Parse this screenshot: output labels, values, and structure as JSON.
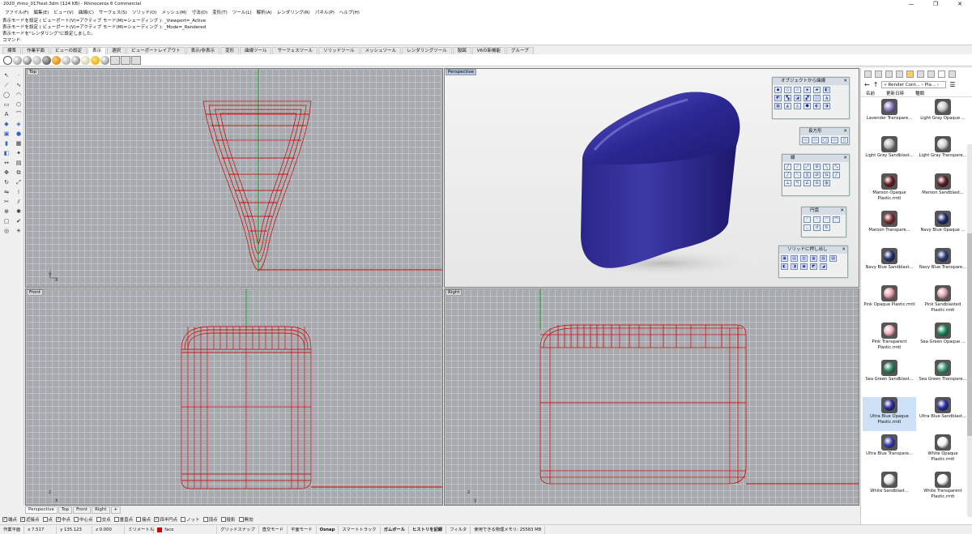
{
  "window": {
    "title": "2020_rhino_017test.3dm (124 KB) - Rhinoceros 6 Commercial",
    "controls": [
      "—",
      "❐",
      "✕"
    ]
  },
  "menu": [
    "ファイル(F)",
    "編集(E)",
    "ビュー(V)",
    "曲線(C)",
    "サーフェス(S)",
    "ソリッド(O)",
    "メッシュ(M)",
    "寸法(D)",
    "変形(T)",
    "ツール(L)",
    "解析(A)",
    "レンダリング(R)",
    "パネル(P)",
    "ヘルプ(H)"
  ],
  "command_history": [
    "表示モードを設定 ( ビューポート(V)=アクティブ  モード(M)=シェーディング ): _Viewport=_Active",
    "表示モードを設定 ( ビューポート(V)=アクティブ  モード(M)=シェーディング ): _Mode=_Rendered",
    "表示モードを\"レンダリング\"に設定しました。",
    "コマンド:"
  ],
  "toolbar_tabs": [
    {
      "label": "標準"
    },
    {
      "label": "作業平面"
    },
    {
      "label": "ビューの設定"
    },
    {
      "label": "表示",
      "active": true
    },
    {
      "label": "選択"
    },
    {
      "label": "ビューポートレイアウト"
    },
    {
      "label": "表示/非表示"
    },
    {
      "label": "変形"
    },
    {
      "label": "曲線ツール"
    },
    {
      "label": "サーフェスツール"
    },
    {
      "label": "ソリッドツール"
    },
    {
      "label": "メッシュツール"
    },
    {
      "label": "レンダリングツール"
    },
    {
      "label": "製図"
    },
    {
      "label": "V6の新機能"
    },
    {
      "label": "グループ"
    }
  ],
  "viewports": {
    "top": "Top",
    "perspective": "Perspective",
    "front": "Front",
    "right": "Right"
  },
  "viewport_tabs": [
    "Perspective",
    "Top",
    "Front",
    "Right",
    "+"
  ],
  "palettes": {
    "surface_from_curves": "オブジェクトから曲線",
    "rectangle": "長方形",
    "line": "線",
    "circle": "円弧",
    "solid_extrude": "ソリッドに押し出し"
  },
  "osnap": [
    {
      "label": "端点",
      "checked": true
    },
    {
      "label": "近接点",
      "checked": true
    },
    {
      "label": "点",
      "checked": false
    },
    {
      "label": "中点",
      "checked": true
    },
    {
      "label": "中心点",
      "checked": false
    },
    {
      "label": "交点",
      "checked": false
    },
    {
      "label": "垂直点",
      "checked": false
    },
    {
      "label": "接点",
      "checked": false
    },
    {
      "label": "四半円点",
      "checked": true
    },
    {
      "label": "ノット",
      "checked": false
    },
    {
      "label": "頂点",
      "checked": false
    },
    {
      "label": "投影",
      "checked": false
    },
    {
      "label": "無効",
      "checked": false
    }
  ],
  "status": {
    "cplane": "作業平面",
    "x": "x 7.517",
    "y": "y 135.123",
    "z": "z 0.000",
    "units": "ミリメートル",
    "layer": "face",
    "grid_snap": "グリッドスナップ",
    "ortho": "直交モード",
    "planar": "平面モード",
    "osnap": "Osnap",
    "smarttrack": "スマートトラック",
    "gumball": "ガムボール",
    "history": "ヒストリを記録",
    "filter": "フィルタ",
    "memory": "使用できる物理メモリ: 25583 MB"
  },
  "panel": {
    "breadcrumb": "« Render Cont... › Pla... ›",
    "columns": [
      "名前",
      "更新日時",
      "種類"
    ],
    "materials": [
      {
        "name": "Lavender Transpare...",
        "color": "#8a7cc0"
      },
      {
        "name": "Light Gray Opaque ...",
        "color": "#c8c8c8"
      },
      {
        "name": "Light Gray Sandblast...",
        "color": "#b8b8b8"
      },
      {
        "name": "Light Gray Transpare...",
        "color": "#d0d0d0"
      },
      {
        "name": "Maroon Opaque Plastic.rmtl",
        "color": "#6a1a22"
      },
      {
        "name": "Maroon Sandblast...",
        "color": "#5a1a20"
      },
      {
        "name": "Maroon Transpare...",
        "color": "#7a2a32"
      },
      {
        "name": "Navy Blue Opaque ...",
        "color": "#1a2a6a"
      },
      {
        "name": "Navy Blue Sandblast...",
        "color": "#22306a"
      },
      {
        "name": "Navy Blue Transpare...",
        "color": "#2a3a7a"
      },
      {
        "name": "Pink Opaque Plastic.rmtl",
        "color": "#e89aa8"
      },
      {
        "name": "Pink Sandblasted Plastic.rmtl",
        "color": "#e0a0ac"
      },
      {
        "name": "Pink Transparent Plastic.rmtl",
        "color": "#f0b0bc"
      },
      {
        "name": "Sea Green Opaque ...",
        "color": "#1e8a5a"
      },
      {
        "name": "Sea Green Sandblast...",
        "color": "#2a8a62"
      },
      {
        "name": "Sea Green Transpare...",
        "color": "#3a9a72"
      },
      {
        "name": "Ultra Blue Opaque Plastic.rmtl",
        "color": "#2a2a9a",
        "selected": true
      },
      {
        "name": "Ultra Blue Sandblast...",
        "color": "#2a2aa0"
      },
      {
        "name": "Ultra Blue Transpare...",
        "color": "#3a3ab0"
      },
      {
        "name": "White Opaque Plastic.rmtl",
        "color": "#f4f4f4"
      },
      {
        "name": "White Sandblast...",
        "color": "#e8e8e8"
      },
      {
        "name": "White Transparent Plastic.rmtl",
        "color": "#fafafa"
      }
    ]
  },
  "colors": {
    "wire": "#cc0000",
    "model": "#2b2790",
    "grid": "#a6aaae"
  }
}
